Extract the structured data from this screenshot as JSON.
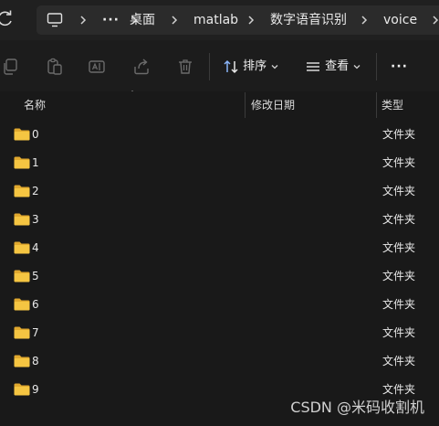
{
  "address": {
    "breadcrumbs": [
      "桌面",
      "matlab",
      "数字语音识别",
      "voice"
    ],
    "more": "···"
  },
  "toolbar": {
    "sort_label": "排序",
    "view_label": "查看",
    "more_label": "···"
  },
  "columns": {
    "name": "名称",
    "modified": "修改日期",
    "type": "类型"
  },
  "files": [
    {
      "name": "0",
      "type": "文件夹"
    },
    {
      "name": "1",
      "type": "文件夹"
    },
    {
      "name": "2",
      "type": "文件夹"
    },
    {
      "name": "3",
      "type": "文件夹"
    },
    {
      "name": "4",
      "type": "文件夹"
    },
    {
      "name": "5",
      "type": "文件夹"
    },
    {
      "name": "6",
      "type": "文件夹"
    },
    {
      "name": "7",
      "type": "文件夹"
    },
    {
      "name": "8",
      "type": "文件夹"
    },
    {
      "name": "9",
      "type": "文件夹"
    }
  ],
  "watermark": "CSDN @米码收割机",
  "colors": {
    "background": "#191919",
    "folder": "#f5c542",
    "folder_dark": "#e0a82e"
  }
}
